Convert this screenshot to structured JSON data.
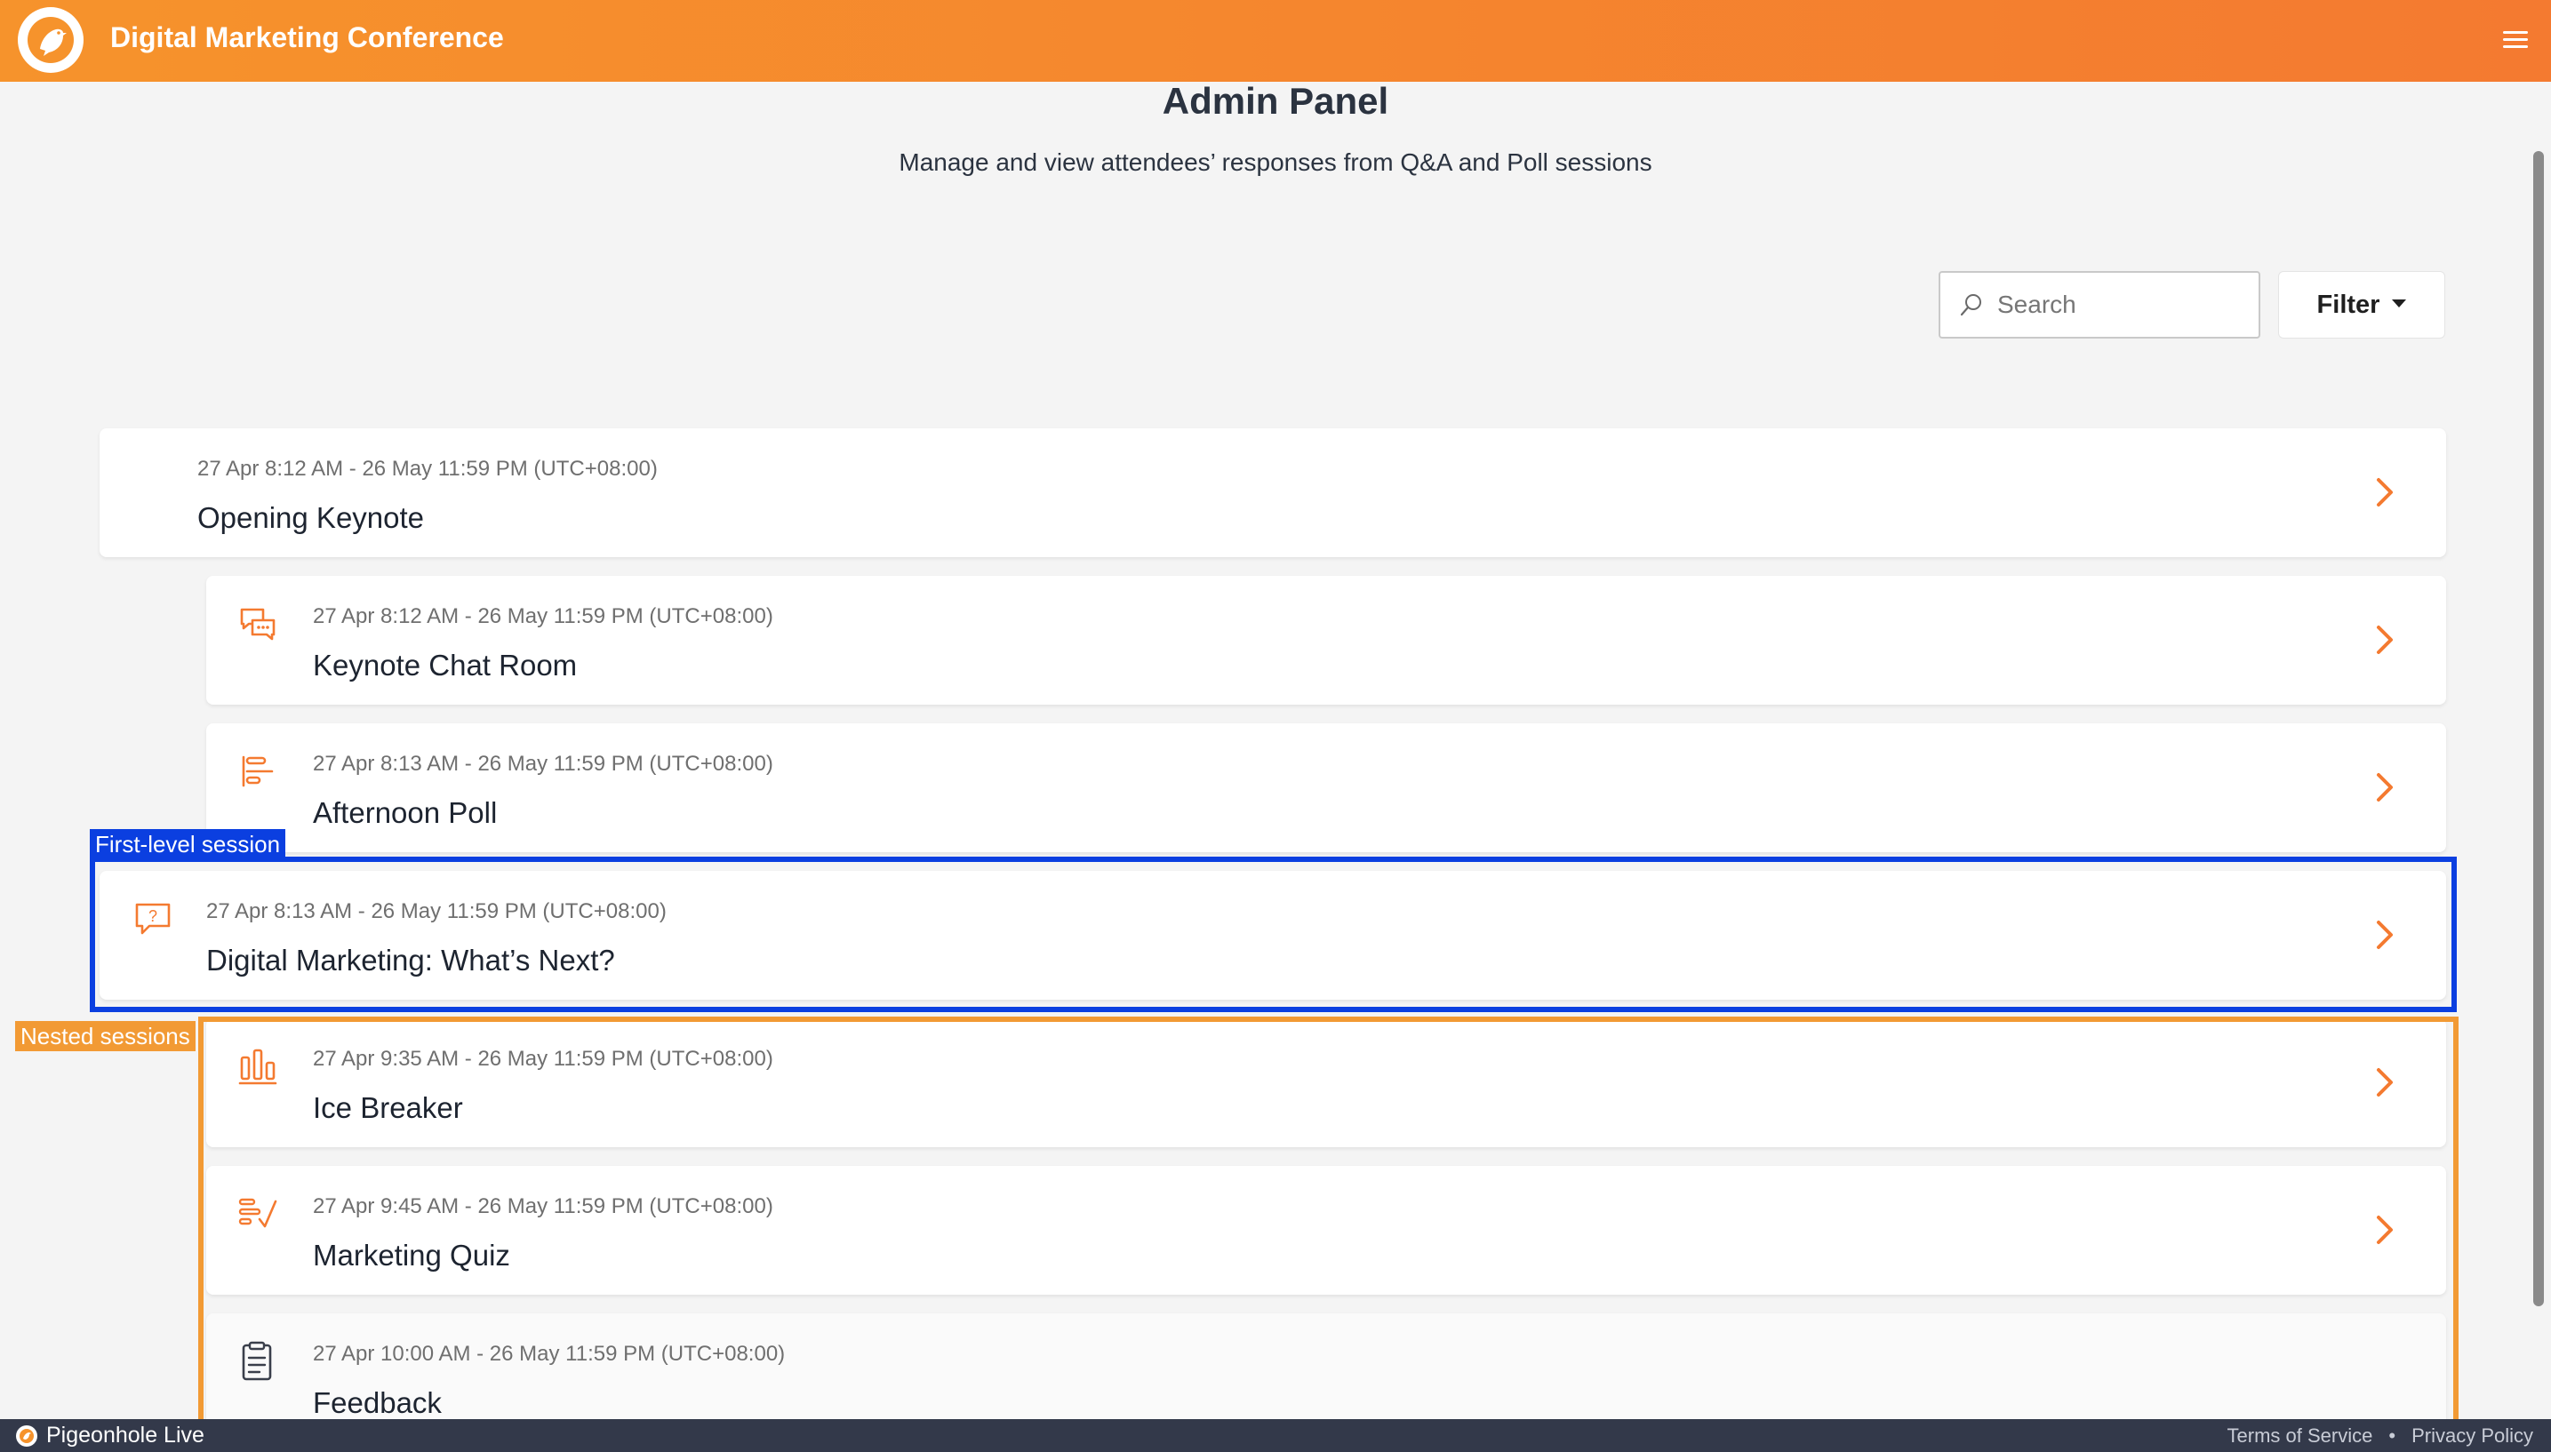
{
  "header": {
    "app_title": "Digital Marketing Conference",
    "logo_icon": "pigeon-icon",
    "menu_icon": "hamburger-menu-icon"
  },
  "page": {
    "title": "Admin Panel",
    "subtitle": "Manage and view attendees’ responses from Q&A and Poll sessions"
  },
  "toolbar": {
    "search_placeholder": "Search",
    "filter_label": "Filter"
  },
  "sessions": [
    {
      "date": "27 Apr 8:12 AM - 26 May 11:59 PM (UTC+08:00)",
      "title": "Opening Keynote",
      "icon": "",
      "level": "parent"
    },
    {
      "date": "27 Apr 8:12 AM - 26 May 11:59 PM (UTC+08:00)",
      "title": "Keynote Chat Room",
      "icon": "chat-icon",
      "level": "nested"
    },
    {
      "date": "27 Apr 8:13 AM - 26 May 11:59 PM (UTC+08:00)",
      "title": "Afternoon Poll",
      "icon": "poll-icon",
      "level": "nested"
    },
    {
      "date": "27 Apr 8:13 AM - 26 May 11:59 PM (UTC+08:00)",
      "title": "Digital Marketing: What’s Next?",
      "icon": "qna-icon",
      "level": "first-level"
    },
    {
      "date": "27 Apr 9:35 AM - 26 May 11:59 PM (UTC+08:00)",
      "title": "Ice Breaker",
      "icon": "bar-chart-icon",
      "level": "nested"
    },
    {
      "date": "27 Apr 9:45 AM - 26 May 11:59 PM (UTC+08:00)",
      "title": "Marketing Quiz",
      "icon": "quiz-icon",
      "level": "nested"
    },
    {
      "date": "27 Apr 10:00 AM - 26 May 11:59 PM (UTC+08:00)",
      "title": "Feedback",
      "icon": "clipboard-icon",
      "level": "nested"
    }
  ],
  "annotations": {
    "first_level": "First-level session",
    "nested": "Nested sessions"
  },
  "footer": {
    "brand": "Pigeonhole Live",
    "terms": "Terms of Service",
    "separator": "•",
    "privacy": "Privacy Policy"
  },
  "colors": {
    "accent": "#f47a30",
    "annotation_blue": "#0b3fe0",
    "annotation_orange": "#f29a34",
    "footer_bg": "#33394a"
  }
}
